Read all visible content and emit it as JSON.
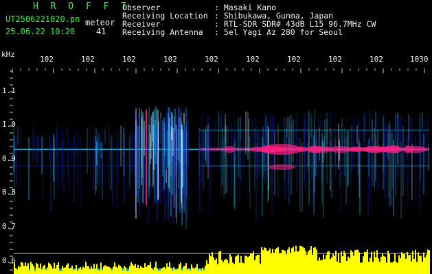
{
  "header": {
    "brand": "H R O F F T",
    "filename": "UT2506221020.pn",
    "datetime": "25.06.22 10:20",
    "meteor_label": "meteor",
    "meteor_count": "41"
  },
  "info": [
    {
      "field": "Observer",
      "value": ": Masaki Kano"
    },
    {
      "field": "Receiving Location",
      "value": ": Shibukawa, Gunma, Japan"
    },
    {
      "field": "Receiver",
      "value": ": RTL-SDR SDR# 43dB L15 96.7MHz CW"
    },
    {
      "field": "Receiving Antenna",
      "value": ": 5el Yagi Az 280 for Seoul"
    }
  ],
  "axes": {
    "y_unit": "kHz",
    "x_ticks": [
      "102",
      "102",
      "102",
      "102",
      "102",
      "102",
      "102",
      "102",
      "102",
      "1030"
    ],
    "y_ticks": [
      "1.1",
      "1.0",
      "0.9",
      "0.8",
      "0.7",
      "0.6"
    ]
  },
  "colors": {
    "text_green": "#22ff33",
    "text_white": "#f2f2f2",
    "signal_low": "#1020c0",
    "signal_mid": "#10d0ff",
    "signal_high": "#ff2080",
    "level_bar": "#ffff00",
    "level_base": "#00c8ff"
  }
}
